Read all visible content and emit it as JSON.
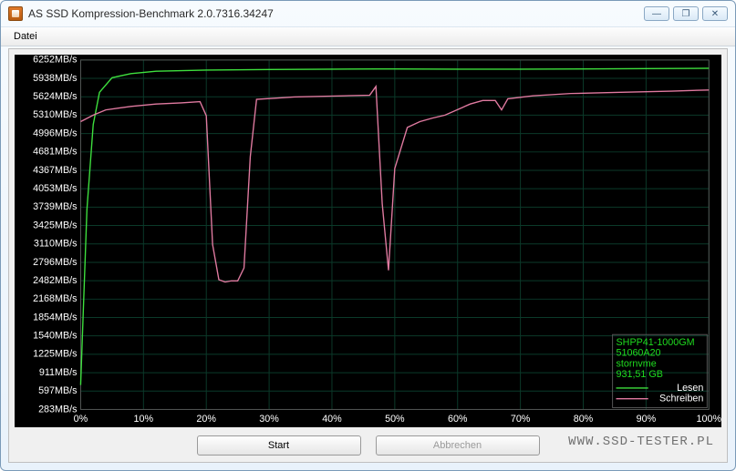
{
  "window": {
    "title": "AS SSD Kompression-Benchmark 2.0.7316.34247",
    "minimize_icon": "—",
    "maximize_icon": "❐",
    "close_icon": "✕"
  },
  "menu": {
    "datei": "Datei"
  },
  "buttons": {
    "start": "Start",
    "abort": "Abbrechen"
  },
  "device_info": {
    "model": "SHPP41-1000GM",
    "fw": "51060A20",
    "driver": "stornvme",
    "capacity": "931,51 GB"
  },
  "legend": {
    "read": "Lesen",
    "write": "Schreiben"
  },
  "watermark": "www.ssd-tester.pl",
  "chart_data": {
    "type": "line",
    "xlabel": "",
    "ylabel": "",
    "x_unit": "%",
    "y_unit": "MB/s",
    "xlim": [
      0,
      100
    ],
    "ylim": [
      283,
      6252
    ],
    "y_ticks": [
      6252,
      5938,
      5624,
      5310,
      4996,
      4681,
      4367,
      4053,
      3739,
      3425,
      3110,
      2796,
      2482,
      2168,
      1854,
      1540,
      1225,
      911,
      597,
      283
    ],
    "x_ticks": [
      0,
      10,
      20,
      30,
      40,
      50,
      60,
      70,
      80,
      90,
      100
    ],
    "series": [
      {
        "name": "Lesen",
        "color": "#3ee03e",
        "x": [
          0,
          1,
          2,
          3,
          5,
          8,
          12,
          20,
          30,
          40,
          47,
          50,
          60,
          70,
          80,
          90,
          100
        ],
        "y": [
          700,
          3700,
          5150,
          5700,
          5950,
          6020,
          6060,
          6080,
          6090,
          6095,
          6100,
          6100,
          6095,
          6095,
          6100,
          6105,
          6110
        ]
      },
      {
        "name": "Schreiben",
        "color": "#e07aa0",
        "x": [
          0,
          2,
          4,
          8,
          12,
          16,
          19,
          20,
          21,
          22,
          23,
          24,
          25,
          26,
          27,
          28,
          34,
          42,
          46,
          47,
          48,
          49,
          50,
          52,
          54,
          56,
          58,
          62,
          64,
          66,
          67,
          68,
          72,
          78,
          86,
          94,
          100
        ],
        "y": [
          5200,
          5310,
          5400,
          5460,
          5500,
          5520,
          5540,
          5300,
          3100,
          2500,
          2460,
          2480,
          2480,
          2700,
          4600,
          5580,
          5620,
          5640,
          5650,
          5800,
          3800,
          2660,
          4400,
          5100,
          5200,
          5260,
          5310,
          5500,
          5560,
          5560,
          5400,
          5590,
          5640,
          5680,
          5700,
          5720,
          5740
        ]
      }
    ]
  }
}
